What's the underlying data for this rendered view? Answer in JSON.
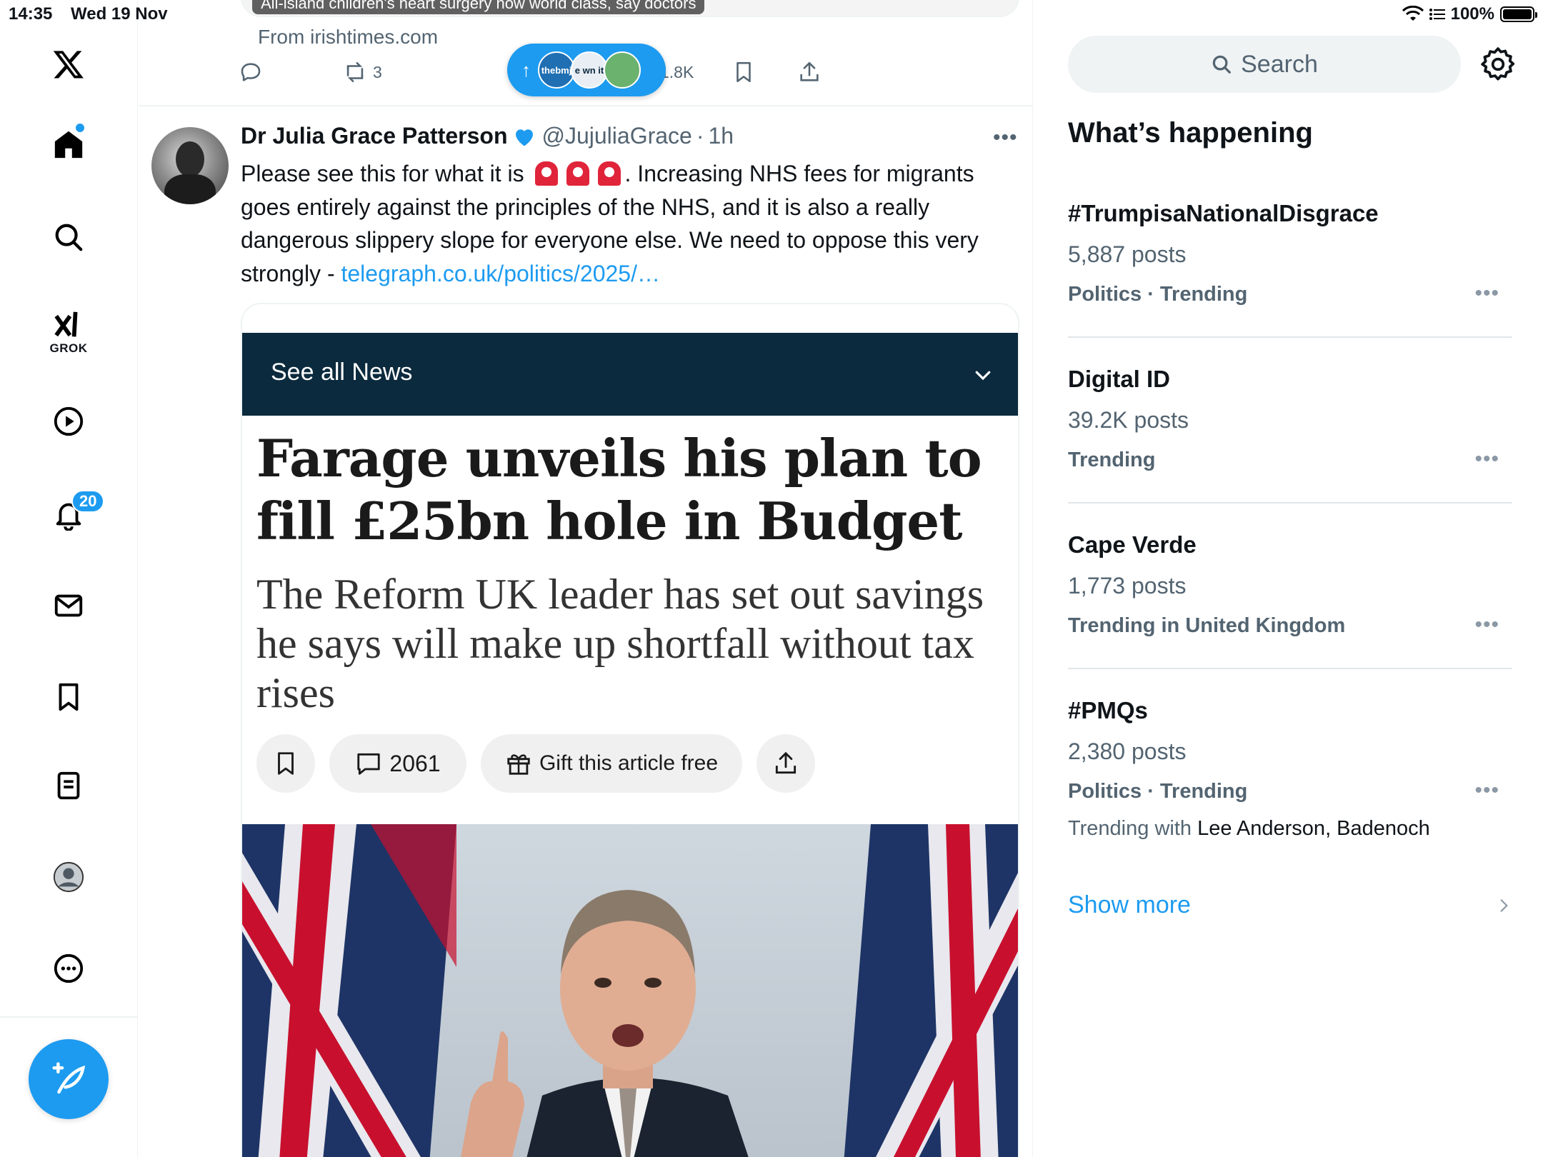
{
  "status_bar": {
    "time": "14:35",
    "date": "Wed 19 Nov",
    "battery": "100%",
    "battery_level": 1.0
  },
  "nav": {
    "notifications_count": "20",
    "grok_label": "GROK"
  },
  "prev_tweet": {
    "card_caption": "All-island children's heart surgery now world class, say doctors",
    "source": "From irishtimes.com",
    "retweets": "3",
    "views": "1.8K"
  },
  "new_posts_pill": {
    "arrow": "↑",
    "avatars": [
      "thebmj",
      "e wn it",
      ""
    ]
  },
  "tweet": {
    "name": "Dr Julia Grace Patterson",
    "handle": "@JujuliaGrace",
    "dot": "·",
    "time": "1h",
    "text_before_emoji": "Please see this for what it is",
    "text_after_emoji": ". Increasing NHS fees for migrants goes entirely against the principles of the NHS, and it is also a really dangerous slippery slope for everyone else. We need to oppose this very strongly -",
    "link": "telegraph.co.uk/politics/2025/…"
  },
  "article": {
    "news_bar_label": "See all News",
    "headline": "Farage unveils his plan to fill £25bn hole in Budget",
    "standfirst": "The Reform UK leader has set out savings he says will make up shortfall without tax rises",
    "comments_count": "2061",
    "gift_label": "Gift this article free"
  },
  "sidebar": {
    "search_placeholder": "Search",
    "section_title": "What’s happening",
    "trends": [
      {
        "name": "#TrumpisaNationalDisgrace",
        "count": "5,887 posts",
        "meta": "Politics · Trending"
      },
      {
        "name": "Digital ID",
        "count": "39.2K posts",
        "meta": "Trending"
      },
      {
        "name": "Cape Verde",
        "count": "1,773 posts",
        "meta": "Trending in United Kingdom"
      },
      {
        "name": "#PMQs",
        "count": "2,380 posts",
        "meta": "Politics · Trending",
        "with_label": "Trending with",
        "with_names": "Lee Anderson, Badenoch"
      }
    ],
    "show_more": "Show more"
  },
  "colors": {
    "accent": "#1d9bf0",
    "news_bar": "#0b2a3e",
    "secondary_text": "#536471"
  }
}
